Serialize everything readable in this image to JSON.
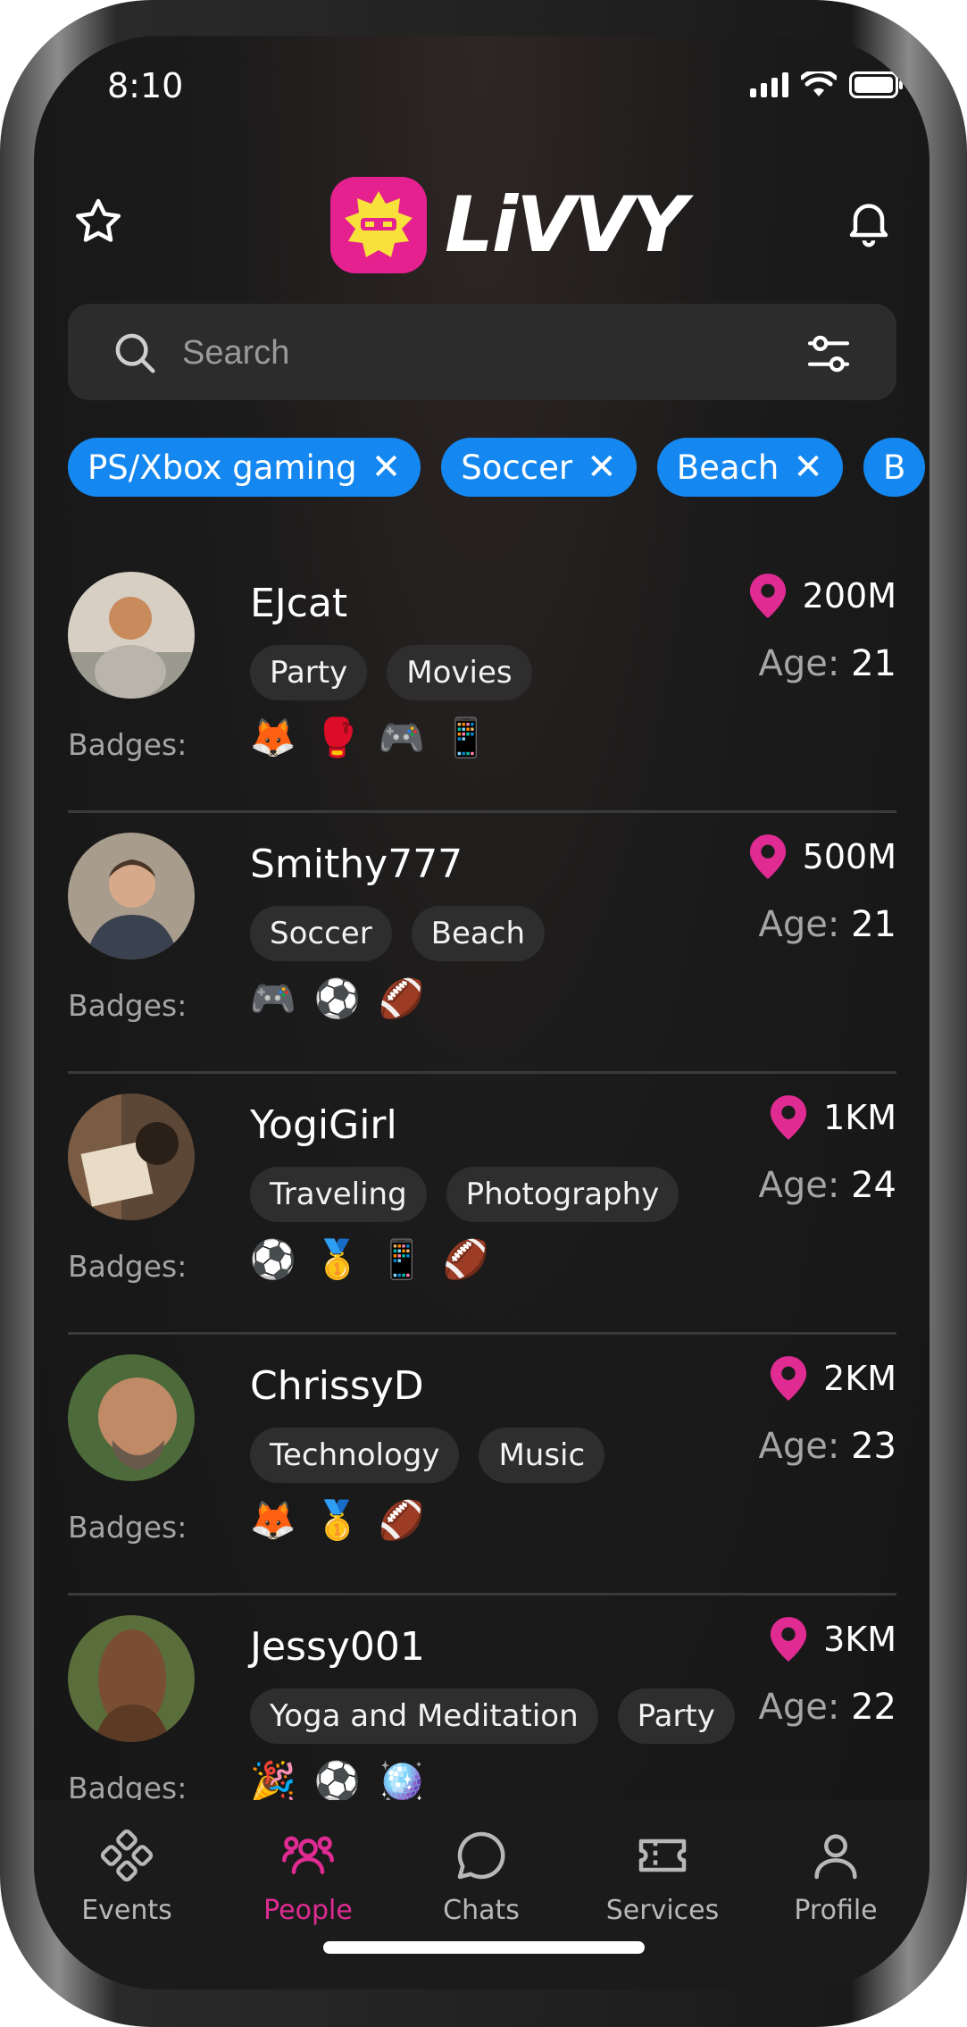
{
  "status_bar": {
    "time": "8:10"
  },
  "header": {
    "app_name": "LiVVY"
  },
  "search": {
    "placeholder": "Search"
  },
  "filter_chips": [
    {
      "label": "PS/Xbox gaming"
    },
    {
      "label": "Soccer"
    },
    {
      "label": "Beach"
    },
    {
      "label": "B"
    }
  ],
  "badges_label": "Badges:",
  "age_label": "Age:",
  "people": [
    {
      "username": "EJcat",
      "distance": "200M",
      "age": "21",
      "tags": [
        "Party",
        "Movies"
      ],
      "badges": [
        "🦊",
        "🥊",
        "🎮",
        "📱"
      ],
      "avatar_color": "#c9b8a6"
    },
    {
      "username": "Smithy777",
      "distance": "500M",
      "age": "21",
      "tags": [
        "Soccer",
        "Beach"
      ],
      "badges": [
        "🎮",
        "⚽",
        "🏈"
      ],
      "avatar_color": "#6e6a62"
    },
    {
      "username": "YogiGirl",
      "distance": "1KM",
      "age": "24",
      "tags": [
        "Traveling",
        "Photography"
      ],
      "badges": [
        "⚽",
        "🥇",
        "📱",
        "🏈"
      ],
      "avatar_color": "#8a6a4e"
    },
    {
      "username": "ChrissyD",
      "distance": "2KM",
      "age": "23",
      "tags": [
        "Technology",
        "Music"
      ],
      "badges": [
        "🦊",
        "🥇",
        "🏈"
      ],
      "avatar_color": "#7c8a5c"
    },
    {
      "username": "Jessy001",
      "distance": "3KM",
      "age": "22",
      "tags": [
        "Yoga and Meditation",
        "Party"
      ],
      "badges": [
        "🎉",
        "⚽",
        "🪩"
      ],
      "avatar_color": "#6a7a4c"
    }
  ],
  "bottom_nav": [
    {
      "label": "Events",
      "icon": "events-icon"
    },
    {
      "label": "People",
      "icon": "people-icon"
    },
    {
      "label": "Chats",
      "icon": "chat-icon"
    },
    {
      "label": "Services",
      "icon": "ticket-icon"
    },
    {
      "label": "Profile",
      "icon": "profile-icon"
    }
  ],
  "colors": {
    "accent": "#e02b93",
    "chip": "#1488f0"
  }
}
